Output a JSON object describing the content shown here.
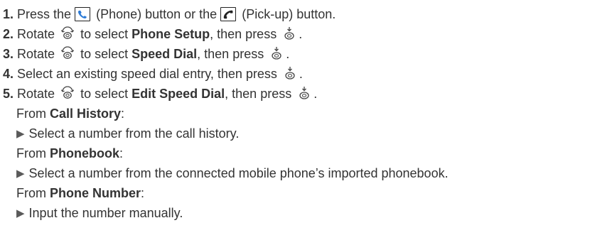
{
  "steps": [
    {
      "num": "1.",
      "pre": "Press the ",
      "mid1": " (Phone) button or the ",
      "mid2": " (Pick-up) button."
    },
    {
      "num": "2.",
      "pre": "Rotate ",
      "mid": " to select ",
      "bold": "Phone Setup",
      "post": ", then press ",
      "end": "."
    },
    {
      "num": "3.",
      "pre": "Rotate ",
      "mid": " to select ",
      "bold": "Speed Dial",
      "post": ", then press ",
      "end": "."
    },
    {
      "num": "4.",
      "pre": "Select an existing speed dial entry, then press ",
      "end": "."
    },
    {
      "num": "5.",
      "pre": "Rotate ",
      "mid": " to select ",
      "bold": "Edit Speed Dial",
      "post": ", then press ",
      "end": "."
    }
  ],
  "options": [
    {
      "from_label": "From ",
      "source": "Call History",
      "colon": ":",
      "action": "Select a number from the call history."
    },
    {
      "from_label": "From ",
      "source": "Phonebook",
      "colon": ":",
      "action": "Select a number from the connected mobile phone’s imported phonebook."
    },
    {
      "from_label": "From ",
      "source": "Phone Number",
      "colon": ":",
      "action": "Input the number manually."
    }
  ],
  "icons": {
    "phone": "phone-button-icon",
    "pickup": "pickup-button-icon",
    "knob": "interface-dial-rotate-icon",
    "press": "interface-dial-press-icon"
  },
  "colors": {
    "text": "#333333",
    "arrow": "#5a5a5a"
  }
}
